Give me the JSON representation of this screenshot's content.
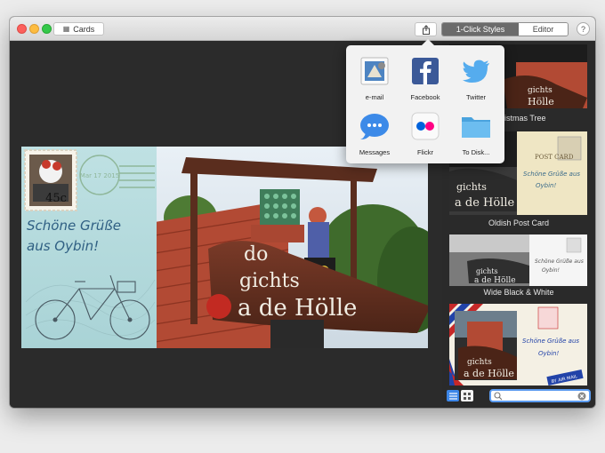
{
  "window": {
    "cards_label": "Cards",
    "styles_tab": "1-Click Styles",
    "editor_tab": "Editor",
    "help_label": "?"
  },
  "main_card": {
    "stamp_value": "45c",
    "postmark_text": "Mar 17 2015",
    "greeting_line1": "Schöne Grüße",
    "greeting_line2": "aus Oybin!",
    "sign_line1": "do",
    "sign_line2": "gichts",
    "sign_line3": "a de Hölle"
  },
  "share_menu": {
    "items": [
      {
        "label": "e-mail",
        "icon": "email-stamp-icon"
      },
      {
        "label": "Facebook",
        "icon": "facebook-icon"
      },
      {
        "label": "Twitter",
        "icon": "twitter-bird-icon"
      },
      {
        "label": "Messages",
        "icon": "messages-bubble-icon"
      },
      {
        "label": "Flickr",
        "icon": "flickr-icon"
      },
      {
        "label": "To Disk...",
        "icon": "folder-icon"
      }
    ]
  },
  "styles": {
    "items": [
      {
        "label": "Christmas Tree"
      },
      {
        "label": "Oldish Post Card",
        "card_title": "POST CARD",
        "card_text1": "Schöne Grüße aus",
        "card_text2": "Oybin!"
      },
      {
        "label": "Wide Black & White",
        "card_text1": "Schöne Grüße aus",
        "card_text2": "Oybin!"
      },
      {
        "label": "",
        "card_text1": "Schöne Grüße aus",
        "card_text2": "Oybin!",
        "airmail": "BY AIR MAIL"
      }
    ]
  },
  "search": {
    "placeholder": ""
  },
  "colors": {
    "accent": "#3c86e8",
    "facebook": "#3b5998",
    "twitter": "#55acee",
    "flickr_pink": "#ff0084",
    "flickr_blue": "#0063dc",
    "folder": "#5fb3ea"
  }
}
